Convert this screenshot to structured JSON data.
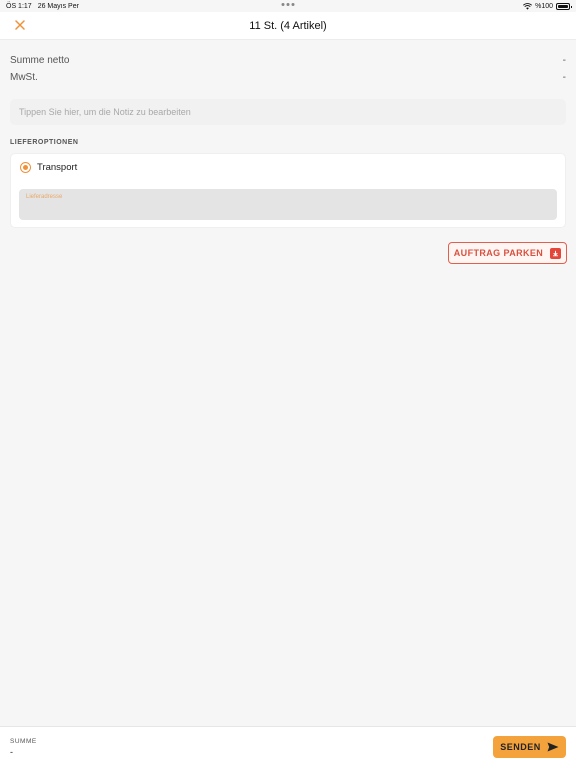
{
  "status_bar": {
    "time": "ÖS 1:17",
    "date": "26 Mayıs Per",
    "battery": "%100"
  },
  "nav": {
    "title": "11 St. (4 Artikel)",
    "close_icon": "close-icon"
  },
  "summary": {
    "net_label": "Summe netto",
    "net_value": "-",
    "vat_label": "MwSt.",
    "vat_value": "-"
  },
  "note": {
    "placeholder": "Tippen Sie hier, um die Notiz zu bearbeiten"
  },
  "delivery": {
    "section_label": "LIEFEROPTIONEN",
    "option_label": "Transport",
    "address_label": "Lieferadresse"
  },
  "actions": {
    "park_label": "AUFTRAG PARKEN",
    "send_label": "SENDEN"
  },
  "footer": {
    "sum_label": "SUMME",
    "sum_value": "-"
  },
  "colors": {
    "accent": "#f0913a",
    "danger": "#e5463a",
    "send": "#f4a23c"
  }
}
